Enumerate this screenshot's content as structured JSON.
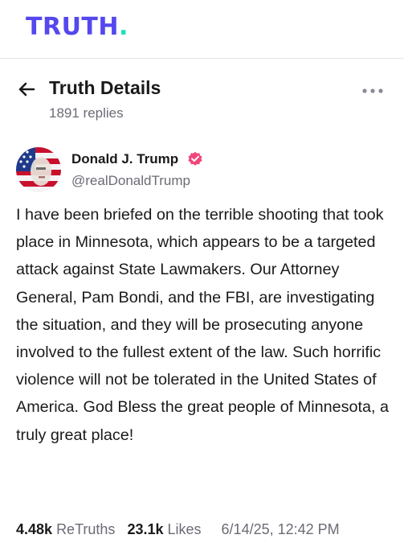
{
  "app": {
    "logo_text": "TRUTH",
    "logo_dot": ".",
    "brand_color": "#5448ee",
    "accent_color": "#17e0c1"
  },
  "header": {
    "back_icon": "arrow-left-icon",
    "title": "Truth Details",
    "replies": "1891 replies",
    "more_icon": "more-horizontal-icon"
  },
  "post": {
    "author": {
      "name": "Donald J. Trump",
      "handle": "@realDonaldTrump",
      "verified_icon": "verified-check-icon"
    },
    "body": "I have been briefed on the terrible shooting that took place in Minnesota, which appears to be a targeted attack against State Lawmakers. Our Attorney General, Pam Bondi, and the FBI, are investigating the situation, and they will be prosecuting anyone involved to the fullest extent of the law. Such horrific violence will not be tolerated in the United States of America. God Bless the great people of Minnesota, a truly great place!",
    "retruths_count": "4.48k",
    "retruths_label": "ReTruths",
    "likes_count": "23.1k",
    "likes_label": "Likes",
    "timestamp": "6/14/25, 12:42 PM"
  }
}
